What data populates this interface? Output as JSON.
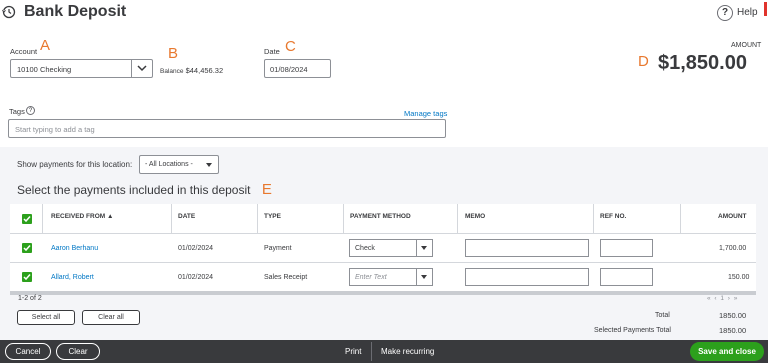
{
  "header": {
    "title": "Bank Deposit",
    "help_label": "Help"
  },
  "annotations": {
    "a": "A",
    "b": "B",
    "c": "C",
    "d": "D",
    "e": "E"
  },
  "account": {
    "label": "Account",
    "value": "10100 Checking",
    "balance_label": "Balance",
    "balance_value": "$44,456.32"
  },
  "date": {
    "label": "Date",
    "value": "01/08/2024"
  },
  "amount": {
    "label": "AMOUNT",
    "value": "$1,850.00"
  },
  "tags": {
    "label": "Tags",
    "manage_label": "Manage tags",
    "placeholder": "Start typing to add a tag"
  },
  "location_filter": {
    "label": "Show payments for this location:",
    "value": "- All Locations -"
  },
  "section_title": "Select the payments included in this deposit",
  "table": {
    "headers": {
      "received_from": "RECEIVED FROM ▲",
      "date": "DATE",
      "type": "TYPE",
      "payment_method": "PAYMENT METHOD",
      "memo": "MEMO",
      "ref_no": "REF NO.",
      "amount": "AMOUNT"
    },
    "rows": [
      {
        "received_from": "Aaron Berhanu",
        "date": "01/02/2024",
        "type": "Payment",
        "payment_method": "Check",
        "memo": "",
        "ref_no": "",
        "amount": "1,700.00",
        "checked": true
      },
      {
        "received_from": "Allard, Robert",
        "date": "01/02/2024",
        "type": "Sales Receipt",
        "payment_method": "Enter Text",
        "memo": "",
        "ref_no": "",
        "amount": "150.00",
        "checked": true
      }
    ],
    "count_label": "1-2 of 2",
    "pager": "« ‹ 1 › »"
  },
  "actions": {
    "select_all": "Select all",
    "clear_all": "Clear all"
  },
  "totals": {
    "total_label": "Total",
    "total_value": "1850.00",
    "selected_label": "Selected Payments Total",
    "selected_value": "1850.00"
  },
  "footer": {
    "cancel": "Cancel",
    "clear": "Clear",
    "print": "Print",
    "make_recurring": "Make recurring",
    "save_close": "Save and close"
  },
  "colors": {
    "accent_green": "#2ca01c",
    "link_blue": "#0077c5",
    "annotation_orange": "#e8792f",
    "footer_bg": "#393a3d"
  }
}
